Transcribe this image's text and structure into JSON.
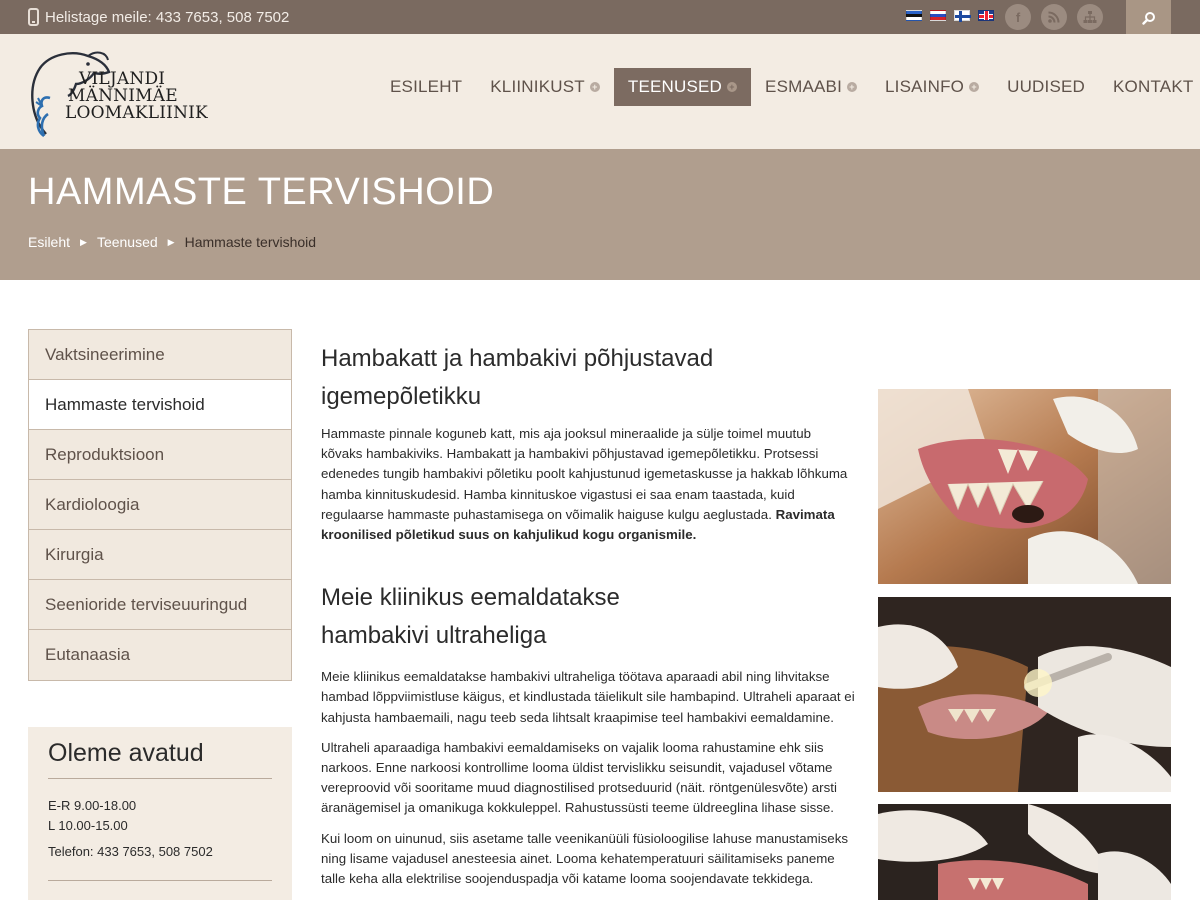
{
  "topbar": {
    "phone_text": "Helistage meile: 433 7653, 508 7502",
    "languages": [
      "ee",
      "ru",
      "fi",
      "uk"
    ],
    "social": [
      "facebook-icon",
      "rss-icon",
      "sitemap-icon"
    ],
    "search_icon": "search-icon"
  },
  "logo": {
    "line1": "VILJANDI",
    "line2": "MÄNNIMÄE",
    "line3": "LOOMAKLIINIK"
  },
  "nav": {
    "items": [
      {
        "label": "ESILEHT",
        "submenu": false
      },
      {
        "label": "KLIINIKUST",
        "submenu": true
      },
      {
        "label": "TEENUSED",
        "submenu": true,
        "active": true
      },
      {
        "label": "ESMAABI",
        "submenu": true
      },
      {
        "label": "LISAINFO",
        "submenu": true
      },
      {
        "label": "UUDISED",
        "submenu": false
      },
      {
        "label": "KONTAKT",
        "submenu": false
      }
    ]
  },
  "banner": {
    "title": "HAMMASTE TERVISHOID",
    "breadcrumb": [
      "Esileht",
      "Teenused",
      "Hammaste tervishoid"
    ]
  },
  "sidebar": {
    "items": [
      {
        "label": "Vaktsineerimine"
      },
      {
        "label": "Hammaste tervishoid",
        "active": true
      },
      {
        "label": "Reproduktsioon"
      },
      {
        "label": "Kardioloogia"
      },
      {
        "label": "Kirurgia"
      },
      {
        "label": "Seenioride terviseuuringud"
      },
      {
        "label": "Eutanaasia"
      }
    ],
    "hours": {
      "title": "Oleme avatud",
      "weekdays": "E-R 9.00-18.00",
      "saturday": "L 10.00-15.00",
      "phone": "Telefon: 433 7653, 508 7502"
    }
  },
  "content": {
    "heading1": "Hambakatt ja hambakivi põhjustavad igemepõletikku",
    "para1": "Hammaste pinnale koguneb katt, mis aja jooksul mineraalide ja sülje toimel muutub kõvaks hambakiviks. Hambakatt ja hambakivi põhjustavad igemepõletikku. Protsessi edenedes tungib hambakivi põletiku poolt kahjustunud igemetaskusse ja hakkab lõhkuma hamba kinnituskudesid.  Hamba kinnituskoe vigastusi ei saa enam taastada, kuid regulaarse hammaste puhastamisega on võimalik haiguse kulgu aeglustada.",
    "para1_bold": "Ravimata kroonilised põletikud suus on kahjulikud kogu organismile.",
    "heading2": "Meie kliinikus eemaldatakse hambakivi ultraheliga",
    "para2": "Meie kliinikus eemaldatakse hambakivi ultraheliga töötava aparaadi abil ning lihvitakse hambad lõppviimistluse käigus, et kindlustada täielikult sile hambapind. Ultraheli aparaat ei kahjusta hambaemaili, nagu teeb seda lihtsalt kraapimise teel hambakivi eemaldamine.",
    "para3": "Ultraheli aparaadiga hambakivi eemaldamiseks on vajalik looma rahustamine ehk siis narkoos. Enne narkoosi kontrollime looma üldist tervislikku seisundit, vajadusel võtame vereproovid või sooritame muud diagnostilised protseduurid (näit. röntgenülesvõte) arsti äranägemisel ja omanikuga kokkuleppel. Rahustussüsti teeme üldreeglina lihase sisse.",
    "para4": "Kui loom on uinunud, siis asetame talle veenikanüüli füsioloogilise lahuse manustamiseks ning lisame vajadusel anesteesia ainet. Looma kehatemperatuuri säilitamiseks paneme talle keha alla elektrilise soojenduspadja või katame looma soojendavate tekkidega."
  },
  "colors": {
    "topbar": "#7a6a60",
    "header": "#f3ece3",
    "banner": "#b09e8e",
    "nav_active": "#7c6b61",
    "sidebar_bg": "#f1e9df",
    "border": "#c8b9aa"
  }
}
